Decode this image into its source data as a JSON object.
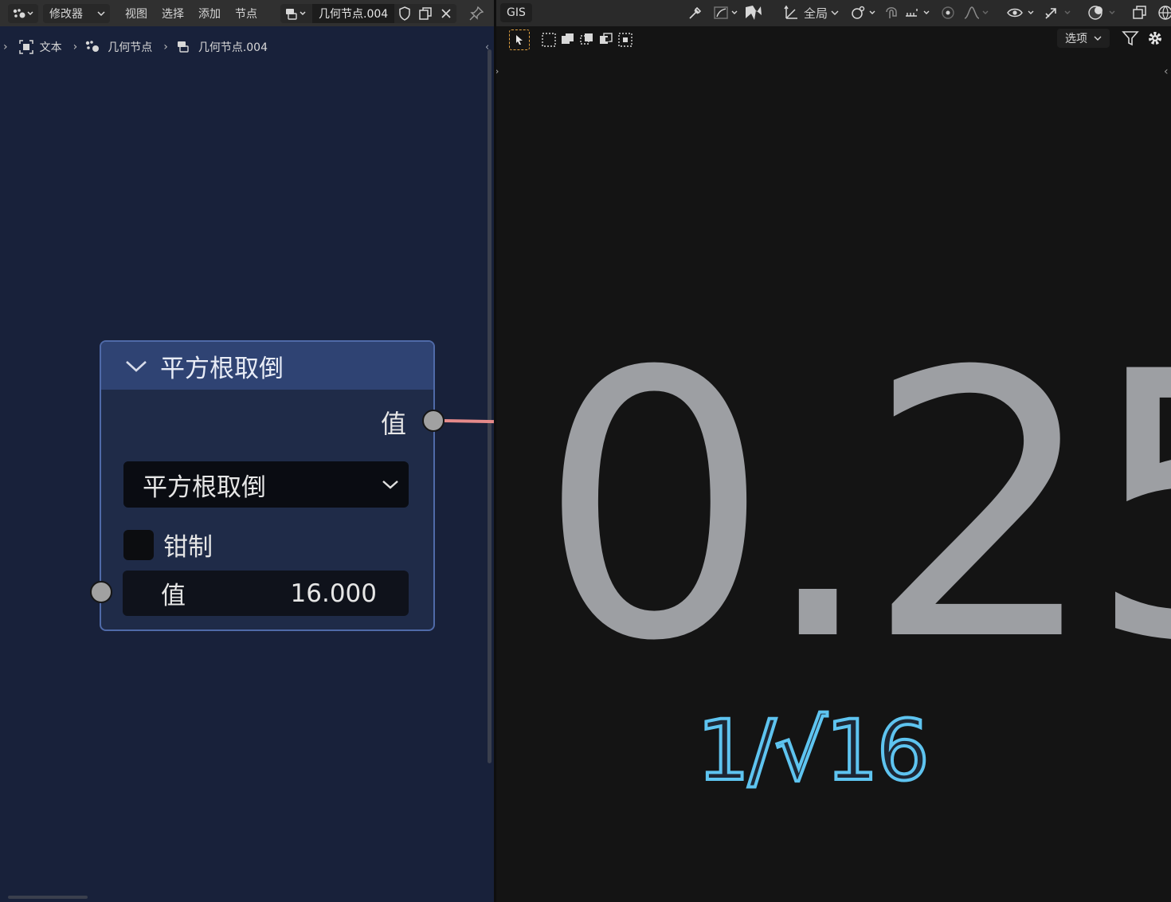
{
  "node_editor": {
    "header": {
      "editor_type_icon": "node-editor-icon",
      "modifier_dropdown": "修改器",
      "menus": [
        "视图",
        "选择",
        "添加",
        "节点"
      ],
      "node_group_name": "几何节点.004",
      "icons": [
        "shield-icon",
        "duplicate-icon",
        "close-icon",
        "pin-icon"
      ]
    },
    "breadcrumb": [
      "文本",
      "几何节点",
      "几何节点.004"
    ],
    "node": {
      "title": "平方根取倒",
      "output_label": "值",
      "operation": "平方根取倒",
      "clamp_label": "钳制",
      "clamp_checked": false,
      "input_label": "值",
      "input_value": "16.000"
    },
    "link_color": "#e58a8a"
  },
  "viewport": {
    "header": {
      "gis_label": "GIS",
      "transform_orientation": "全局",
      "options_label": "选项"
    },
    "result_text": "0.25",
    "formula_text": "1/√16",
    "formula_color": "#5ec4f0"
  }
}
